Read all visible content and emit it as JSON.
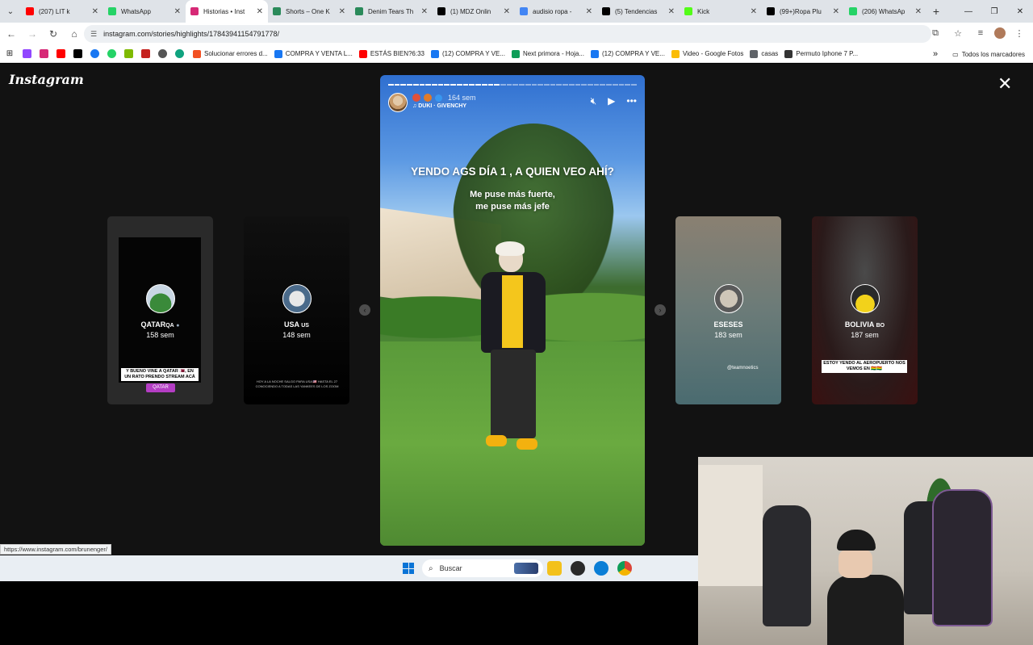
{
  "browser": {
    "tabs": [
      {
        "label": "(207) LIT k",
        "color": "#ff0000",
        "active": false
      },
      {
        "label": "WhatsApp",
        "color": "#25d366",
        "active": false
      },
      {
        "label": "Historias • Inst",
        "color": "#d62976",
        "active": true
      },
      {
        "label": "Shorts – One K",
        "color": "#2a8a5a",
        "active": false
      },
      {
        "label": "Denim Tears Th",
        "color": "#2a8a5a",
        "active": false
      },
      {
        "label": "(1) MDZ Onlin",
        "color": "#000000",
        "active": false
      },
      {
        "label": "audisio ropa -",
        "color": "#4285f4",
        "active": false
      },
      {
        "label": "(5) Tendencias",
        "color": "#000000",
        "active": false
      },
      {
        "label": "Kick",
        "color": "#53fc18",
        "active": false
      },
      {
        "label": "(99+)Ropa Plu",
        "color": "#000000",
        "active": false
      },
      {
        "label": "(206) WhatsAp",
        "color": "#25d366",
        "active": false
      }
    ],
    "url": "instagram.com/stories/highlights/17843941154791778/",
    "bookmarks": [
      {
        "label": "Solucionar errores d...",
        "color": "#f25022"
      },
      {
        "label": "COMPRA Y VENTA L...",
        "color": "#1877f2"
      },
      {
        "label": "ESTÁS BIEN?6:33",
        "color": "#ff0000"
      },
      {
        "label": "(12) COMPRA Y VE...",
        "color": "#1877f2"
      },
      {
        "label": "Next primora - Hoja...",
        "color": "#0f9d58"
      },
      {
        "label": "(12) COMPRA Y VE...",
        "color": "#1877f2"
      },
      {
        "label": "Video - Google Fotos",
        "color": "#fbbc05"
      },
      {
        "label": "casas",
        "color": "#5f6368"
      },
      {
        "label": "Permuto Iphone 7 P...",
        "color": "#333333"
      }
    ],
    "bookmarks_more": "»",
    "all_bookmarks": "Todos los marcadores"
  },
  "page": {
    "logo": "Instagram",
    "close": "✕"
  },
  "story": {
    "time": "164 sem",
    "song": "DUKI · GIVENCHY",
    "text_main": "YENDO AGS DÍA 1 , A QUIEN VEO AHÍ?",
    "text_sub_1": "Me puse más fuerte,",
    "text_sub_2": "me puse más jefe",
    "progress_segments": 40,
    "progress_done": 18
  },
  "side_stories": [
    {
      "name": "QATAR",
      "flag": "QA",
      "time": "158 sem",
      "caption": "Y BUENO VINE A QATAR 🇶🇦, EN UN RATO PRENDO STREAM ACÁ",
      "location": "QATAR"
    },
    {
      "name": "USA",
      "flag": "US",
      "time": "148 sem",
      "caption": "HOY A LA NOCHE SALGO PARA USA 🇺🇸 HASTA EL 27 CONOCIENDO A TODAS LAS YANKEES DE LOS ZOOM"
    },
    {
      "name": "ESESES",
      "time": "183 sem",
      "tag": "@teamnoetics"
    },
    {
      "name": "BOLIVIA",
      "flag": "BO",
      "time": "187 sem",
      "caption": "ESTOY YENDO AL AEROPUERTO NOS VEMOS EN 🇧🇴🇧🇴"
    }
  ],
  "status_url": "https://www.instagram.com/brunenger/",
  "taskbar": {
    "search": "Buscar"
  }
}
